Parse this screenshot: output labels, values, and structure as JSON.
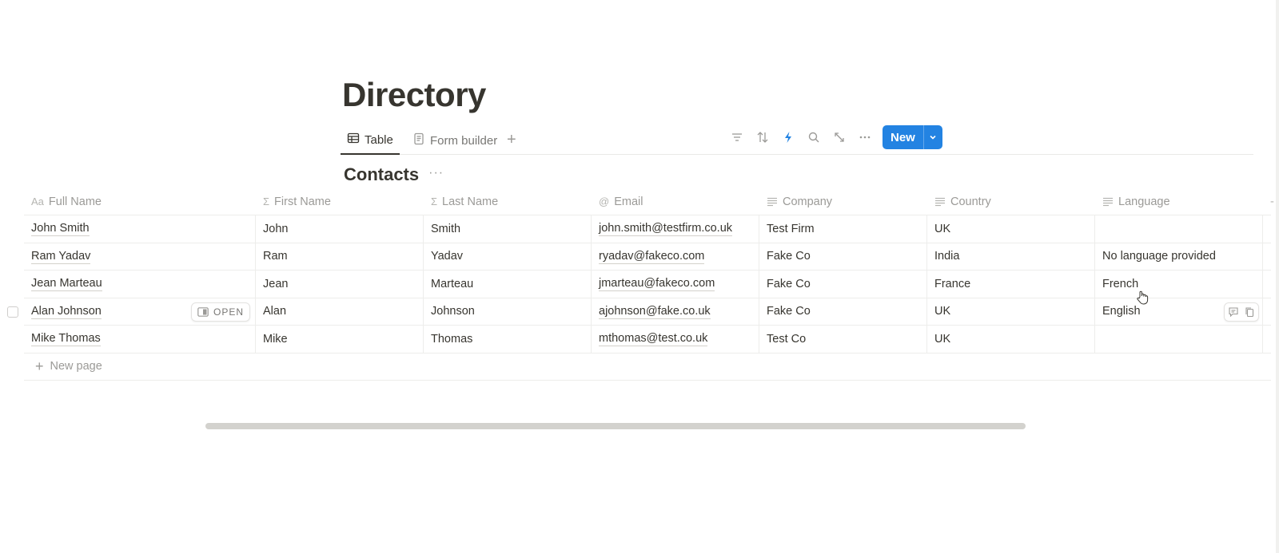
{
  "page": {
    "title": "Directory"
  },
  "views": {
    "tabs": [
      {
        "label": "Table",
        "icon": "table-icon",
        "active": true
      },
      {
        "label": "Form builder",
        "icon": "form-icon",
        "active": false
      }
    ],
    "add_view_icon": "plus-icon"
  },
  "toolbar": {
    "icons": [
      "filter-icon",
      "sort-icon",
      "automation-lightning-icon",
      "search-icon",
      "expand-icon",
      "more-icon"
    ],
    "new_label": "New",
    "accent_color": "#2383e2"
  },
  "database": {
    "title": "Contacts",
    "more_label": "···"
  },
  "table": {
    "columns": [
      {
        "label": "Full Name",
        "icon_text": "Aa",
        "type": "title"
      },
      {
        "label": "First Name",
        "icon_text": "Σ",
        "type": "formula"
      },
      {
        "label": "Last Name",
        "icon_text": "Σ",
        "type": "formula"
      },
      {
        "label": "Email",
        "icon_text": "@",
        "type": "email"
      },
      {
        "label": "Company",
        "icon_text": "≡",
        "type": "text"
      },
      {
        "label": "Country",
        "icon_text": "≡",
        "type": "text"
      },
      {
        "label": "Language",
        "icon_text": "≡",
        "type": "text"
      }
    ],
    "rows": [
      {
        "full_name": "John Smith",
        "first_name": "John",
        "last_name": "Smith",
        "email": "john.smith@testfirm.co.uk",
        "company": "Test Firm",
        "country": "UK",
        "language": ""
      },
      {
        "full_name": "Ram Yadav",
        "first_name": "Ram",
        "last_name": "Yadav",
        "email": "ryadav@fakeco.com",
        "company": "Fake Co",
        "country": "India",
        "language": "No language provided"
      },
      {
        "full_name": "Jean Marteau",
        "first_name": "Jean",
        "last_name": "Marteau",
        "email": "jmarteau@fakeco.com",
        "company": "Fake Co",
        "country": "France",
        "language": "French"
      },
      {
        "full_name": "Alan Johnson",
        "first_name": "Alan",
        "last_name": "Johnson",
        "email": "ajohnson@fake.co.uk",
        "company": "Fake Co",
        "country": "UK",
        "language": "English"
      },
      {
        "full_name": "Mike Thomas",
        "first_name": "Mike",
        "last_name": "Thomas",
        "email": "mthomas@test.co.uk",
        "company": "Test Co",
        "country": "UK",
        "language": ""
      }
    ],
    "open_label": "OPEN",
    "new_page_label": "New page"
  }
}
